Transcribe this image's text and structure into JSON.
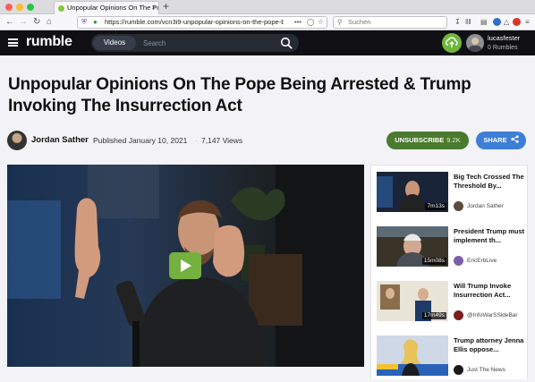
{
  "browser": {
    "tab_title": "Unpopular Opinions On The Pope Being Arrested & Trump Invoking The Insurrection Act",
    "url": "https://rumble.com/vcn3i9-unpopular-opinions-on-the-pope-b",
    "search_placeholder": "Suchen",
    "new_tab": "+",
    "close": "×",
    "nav_icons": [
      "back-icon",
      "forward-icon",
      "reload-icon",
      "home-icon"
    ]
  },
  "header": {
    "logo": "rumble",
    "videos_label": "Videos",
    "search_placeholder": "Search",
    "username": "lucasfester",
    "rumbles": "0 Rumbles"
  },
  "video": {
    "title": "Unpopular Opinions On The Pope Being Arrested & Trump Invoking The Insurrection Act",
    "channel": "Jordan Sather",
    "published": "Published January 10, 2021",
    "views": "7,147 Views",
    "subscribe_label": "UNSUBSCRIBE",
    "subscriber_count": "9.2K",
    "share_label": "SHARE"
  },
  "related": [
    {
      "title": "Big Tech Crossed The Threshold By...",
      "channel": "Jordan Sather",
      "duration": "7m13s"
    },
    {
      "title": "President Trump must implement th...",
      "channel": "EricErbLive",
      "duration": "15m08s"
    },
    {
      "title": "Will Trump Invoke Insurrection Act...",
      "channel": "@InfoWarSSideBar",
      "duration": "17m49s"
    },
    {
      "title": "Trump attorney Jenna Ellis oppose...",
      "channel": "Just The News",
      "duration": ""
    }
  ],
  "colors": {
    "accent": "#85c742",
    "subscribe": "#4a7a2e",
    "share": "#3d7fd6",
    "header": "#0f0f14"
  }
}
